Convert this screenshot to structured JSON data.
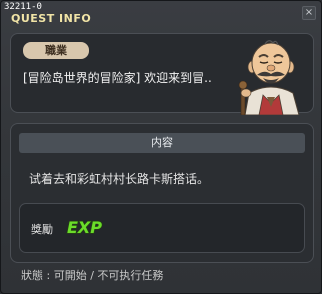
{
  "window": {
    "quest_id": "32211-0",
    "title": "QUEST INFO"
  },
  "npc": {
    "job_label": "職業",
    "greeting": "[冒险岛世界的冒险家] 欢迎来到冒..",
    "portrait_icon": "elder-npc-portrait"
  },
  "content": {
    "header": "内容",
    "text": "试着去和彩虹村村长路卡斯搭话。"
  },
  "reward": {
    "label": "獎勵",
    "exp_text": "EXP",
    "exp_color": "#6bdc2a"
  },
  "status": {
    "text": "狀態 : 可開始 / 不可执行任務"
  }
}
